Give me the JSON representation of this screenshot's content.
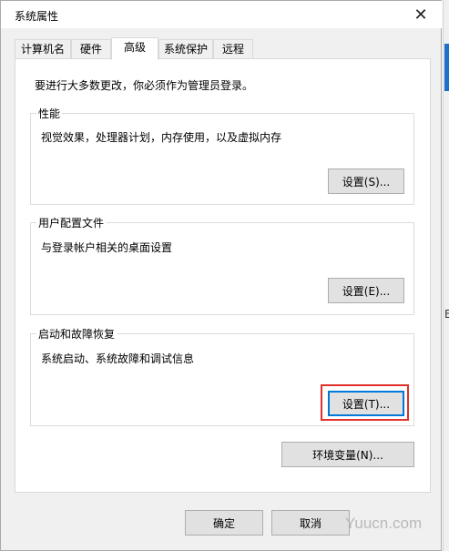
{
  "window": {
    "title": "系统属性",
    "close_glyph": "✕"
  },
  "tabs": [
    {
      "label": "计算机名",
      "active": false
    },
    {
      "label": "硬件",
      "active": false
    },
    {
      "label": "高级",
      "active": true
    },
    {
      "label": "系统保护",
      "active": false
    },
    {
      "label": "远程",
      "active": false
    }
  ],
  "advanced": {
    "note": "要进行大多数更改，你必须作为管理员登录。",
    "performance": {
      "title": "性能",
      "desc": "视觉效果，处理器计划，内存使用，以及虚拟内存",
      "button": "设置(S)..."
    },
    "profiles": {
      "title": "用户配置文件",
      "desc": "与登录帐户相关的桌面设置",
      "button": "设置(E)..."
    },
    "startup": {
      "title": "启动和故障恢复",
      "desc": "系统启动、系统故障和调试信息",
      "button": "设置(T)..."
    },
    "env_button": "环境变量(N)..."
  },
  "footer": {
    "ok": "确定",
    "cancel": "取消"
  },
  "watermark": "Yuucn.com",
  "background_mark": "B",
  "colors": {
    "focus": "#0078d7",
    "highlight": "#e0312b",
    "accent_strip": "#1e6fc9"
  }
}
